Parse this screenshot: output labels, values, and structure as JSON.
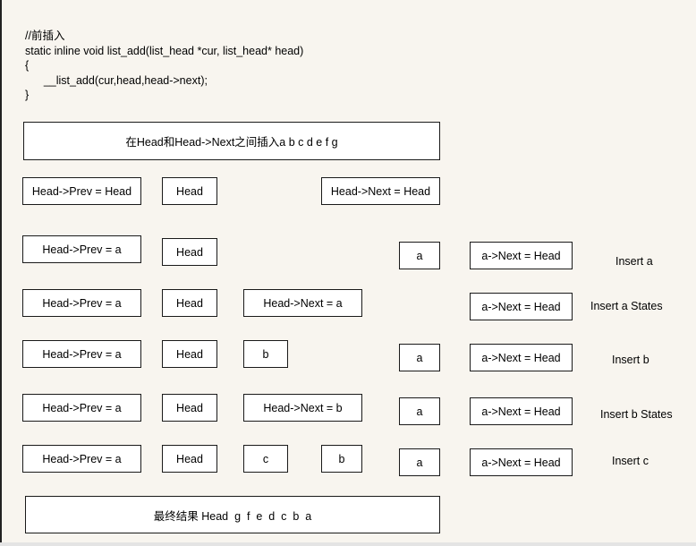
{
  "code": {
    "comment": "//前插入",
    "signature": "static inline void list_add(list_head *cur, list_head* head)",
    "open_brace": "{",
    "body": "      __list_add(cur,head,head->next);",
    "close_brace": "}"
  },
  "title_box": "在Head和Head->Next之间插入a b c d e f g",
  "rows": [
    {
      "boxes": [
        "Head->Prev = Head",
        "Head",
        "Head->Next = Head"
      ],
      "label": ""
    },
    {
      "boxes": [
        "Head->Prev = a",
        "Head",
        "a",
        "a->Next = Head"
      ],
      "label": "Insert a"
    },
    {
      "boxes": [
        "Head->Prev = a",
        "Head",
        "Head->Next = a",
        "a->Next = Head"
      ],
      "label": "Insert a States"
    },
    {
      "boxes": [
        "Head->Prev = a",
        "Head",
        "b",
        "a",
        "a->Next = Head"
      ],
      "label": "Insert b"
    },
    {
      "boxes": [
        "Head->Prev = a",
        "Head",
        "Head->Next = b",
        "a",
        "a->Next = Head"
      ],
      "label": "Insert b States"
    },
    {
      "boxes": [
        "Head->Prev = a",
        "Head",
        "c",
        "b",
        "a",
        "a->Next = Head"
      ],
      "label": "Insert c"
    }
  ],
  "result_box": "最终结果 Head  g  f  e  d  c  b  a"
}
